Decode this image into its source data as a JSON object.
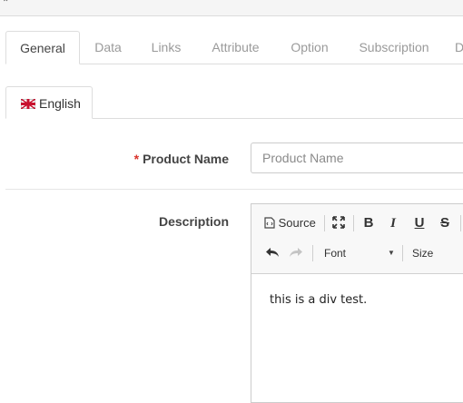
{
  "tabs": [
    {
      "label": "General",
      "active": true
    },
    {
      "label": "Data"
    },
    {
      "label": "Links"
    },
    {
      "label": "Attribute"
    },
    {
      "label": "Option"
    },
    {
      "label": "Subscription"
    },
    {
      "label": "D"
    }
  ],
  "language_tab": {
    "label": "English",
    "icon": "uk-flag-icon"
  },
  "form": {
    "product_name": {
      "required_mark": "*",
      "label": "Product Name",
      "value": "",
      "placeholder": "Product Name"
    },
    "description": {
      "label": "Description",
      "toolbar": {
        "source_label": "Source",
        "font_label": "Font",
        "size_label": "Size",
        "bold_label": "B",
        "italic_label": "I",
        "underline_label": "U",
        "strike_label": "S"
      },
      "content": "this is a div test."
    }
  },
  "colors": {
    "required": "#d9332b",
    "tab_inactive_text": "#9a9a9a",
    "border": "#dddddd"
  }
}
